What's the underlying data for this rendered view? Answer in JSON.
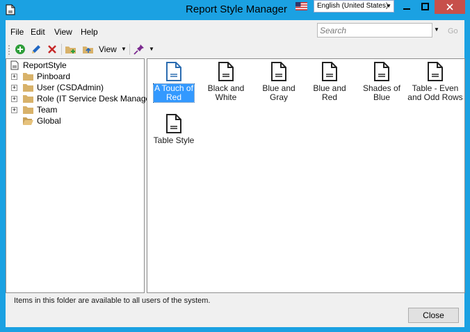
{
  "window": {
    "title": "Report Style Manager",
    "language": "English (United States)",
    "minimize_glyph": "—",
    "maximize_glyph": "□",
    "close_glyph": "✕"
  },
  "menu": {
    "items": [
      "File",
      "Edit",
      "View",
      "Help"
    ]
  },
  "search": {
    "placeholder": "Search",
    "go_label": "Go"
  },
  "toolbar": {
    "view_label": "View"
  },
  "tree": {
    "root_label": "ReportStyle",
    "items": [
      {
        "label": "Pinboard",
        "expandable": true
      },
      {
        "label": "User (CSDAdmin)",
        "expandable": true
      },
      {
        "label": "Role (IT Service Desk Manager)",
        "expandable": true
      },
      {
        "label": "Team",
        "expandable": true
      },
      {
        "label": "Global",
        "expandable": false,
        "selected": true
      }
    ]
  },
  "files": [
    {
      "line1": "A Touch of",
      "line2": "Red",
      "selected": true
    },
    {
      "line1": "Black and",
      "line2": "White",
      "selected": false
    },
    {
      "line1": "Blue and Gray",
      "line2": "",
      "selected": false
    },
    {
      "line1": "Blue and Red",
      "line2": "",
      "selected": false
    },
    {
      "line1": "Shades of",
      "line2": "Blue",
      "selected": false
    },
    {
      "line1": "Table - Even",
      "line2": "and Odd Rows",
      "selected": false
    },
    {
      "line1": "Table Style",
      "line2": "",
      "selected": false
    }
  ],
  "status": {
    "text": "Items in this folder are available to all users of the system."
  },
  "buttons": {
    "close_label": "Close"
  },
  "colors": {
    "titlebar": "#1ba1e2",
    "selection": "#3399ff",
    "close_button": "#c7504b"
  }
}
